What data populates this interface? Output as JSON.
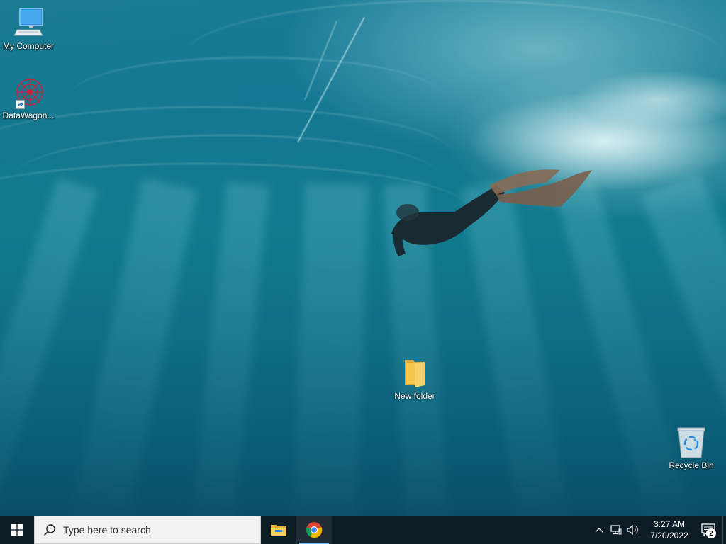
{
  "desktop": {
    "icons": [
      {
        "label": "My Computer",
        "icon": "computer-icon"
      },
      {
        "label": "DataWagon...",
        "icon": "datawagon-icon"
      },
      {
        "label": "New folder",
        "icon": "folder-icon"
      },
      {
        "label": "Recycle Bin",
        "icon": "recycle-bin-icon"
      }
    ]
  },
  "taskbar": {
    "search_placeholder": "Type here to search",
    "apps": [
      {
        "name": "File Explorer",
        "icon": "file-explorer-icon"
      },
      {
        "name": "Google Chrome",
        "icon": "chrome-icon"
      }
    ],
    "tray": {
      "time": "3:27 AM",
      "date": "7/20/2022",
      "notification_count": "2"
    }
  },
  "colors": {
    "taskbar_bg": "#0d1b24",
    "search_bg": "#f2f2f2",
    "accent": "#76b9ed",
    "folder_yellow": "#f5c84c"
  }
}
